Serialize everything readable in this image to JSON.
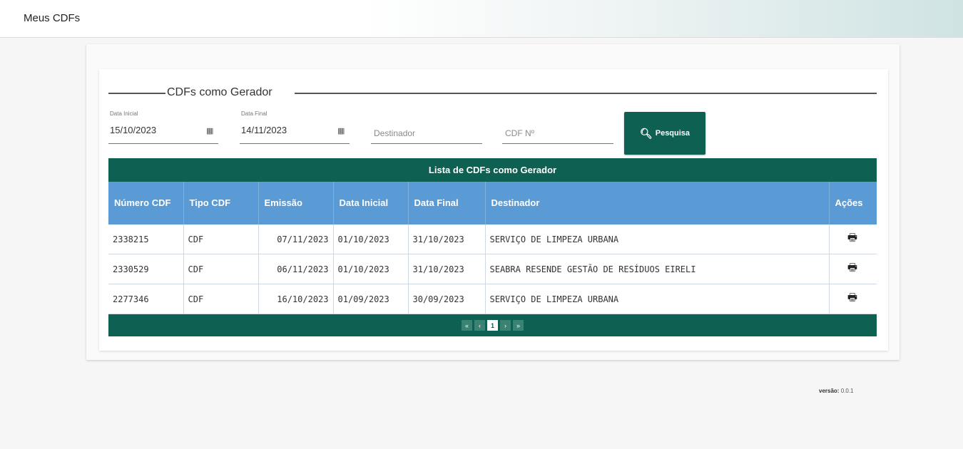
{
  "header": {
    "title": "Meus CDFs"
  },
  "section": {
    "legend": "CDFs como Gerador"
  },
  "filters": {
    "data_inicial_label": "Data Inicial",
    "data_inicial_value": "15/10/2023",
    "data_final_label": "Data Final",
    "data_final_value": "14/11/2023",
    "destinador_placeholder": "Destinador",
    "cdf_placeholder": "CDF Nº",
    "search_label": "Pesquisa"
  },
  "table": {
    "caption": "Lista de CDFs como Gerador",
    "columns": [
      "Número CDF",
      "Tipo CDF",
      "Emissão",
      "Data Inicial",
      "Data Final",
      "Destinador",
      "Ações"
    ],
    "rows": [
      [
        "2338215",
        "CDF",
        "07/11/2023",
        "01/10/2023",
        "31/10/2023",
        "SERVIÇO DE LIMPEZA URBANA"
      ],
      [
        "2330529",
        "CDF",
        "06/11/2023",
        "01/10/2023",
        "31/10/2023",
        "SEABRA RESENDE GESTÃO DE RESÍDUOS EIRELI"
      ],
      [
        "2277346",
        "CDF",
        "16/10/2023",
        "01/09/2023",
        "30/09/2023",
        "SERVIÇO DE LIMPEZA URBANA"
      ]
    ]
  },
  "pagination": {
    "first": "«",
    "prev": "‹",
    "current": "1",
    "next": "›",
    "last": "»"
  },
  "footer": {
    "version_label": "versão:",
    "version_value": "0.0.1"
  },
  "icons": {
    "calendar": "calendar-icon",
    "search": "search-icon",
    "print": "print-icon"
  },
  "colors": {
    "primary": "#0e6152",
    "header_row": "#5b9bd5"
  }
}
